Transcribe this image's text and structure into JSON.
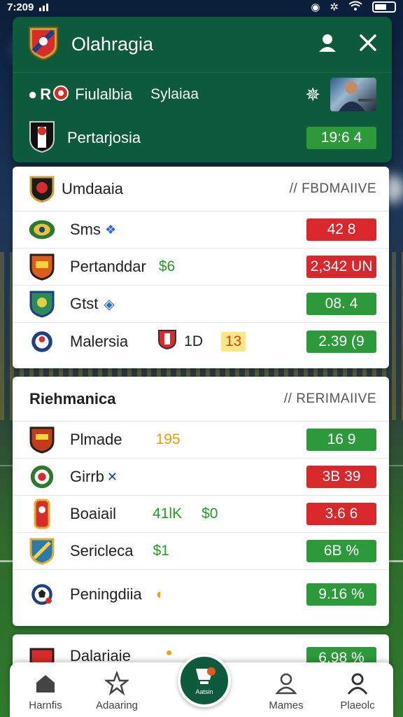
{
  "status_bar": {
    "time": "7:209"
  },
  "header": {
    "title": "Olahragia",
    "league_prefix": "R",
    "league_name": "Fiulalbia",
    "league_sub": "Sylaiaa",
    "featured_team": "Pertarjosia",
    "featured_score": "19:6  4"
  },
  "section1": {
    "title": "Umdaaia",
    "subtitle": "// FBDMAIIVE",
    "rows": [
      {
        "name": "Sms",
        "tag": "",
        "tag2": "",
        "odds": "42  8",
        "odds_color": "#d9282c"
      },
      {
        "name": "Pertanddar",
        "tag": "$6",
        "tag2": "",
        "odds": "2,342 UN",
        "odds_color": "#d9282c"
      },
      {
        "name": "Gtst",
        "tag": "",
        "tag2": "",
        "odds": "08.  4",
        "odds_color": "#2c9a3a"
      },
      {
        "name": "Malersia",
        "tag": "1D",
        "tag2": "13",
        "odds": "2.39 (9",
        "odds_color": "#2c9a3a"
      }
    ]
  },
  "section2": {
    "title": "Riehmanica",
    "subtitle": "// RERIMAIIVE",
    "rows": [
      {
        "name": "Plmade",
        "tag": "195",
        "tag2": "",
        "odds": "16  9",
        "odds_color": "#2c9a3a"
      },
      {
        "name": "Girrb",
        "tag": "",
        "tag2": "",
        "odds": "3B 39",
        "odds_color": "#d9282c"
      },
      {
        "name": "Boaiail",
        "tag": "41lK",
        "tag2": "$0",
        "odds": "3.6  6",
        "odds_color": "#d9282c"
      },
      {
        "name": "Sericleca",
        "tag": "$1",
        "tag2": "",
        "odds": "6B  %",
        "odds_color": "#2c9a3a"
      },
      {
        "name": "Peningdiia",
        "tag": "",
        "tag2": "",
        "odds": "9.16 %",
        "odds_color": "#2c9a3a"
      }
    ]
  },
  "section3": {
    "title": "Dalariaie",
    "odds": "6.98 %"
  },
  "nav": {
    "items": [
      {
        "label": "Harnfis",
        "icon": "home-icon"
      },
      {
        "label": "Adaaring",
        "icon": "star-icon"
      },
      {
        "label": "Mames",
        "icon": "user-icon"
      },
      {
        "label": "Plaeolc",
        "icon": "profile-icon"
      }
    ],
    "center_label": "Aatsin"
  }
}
